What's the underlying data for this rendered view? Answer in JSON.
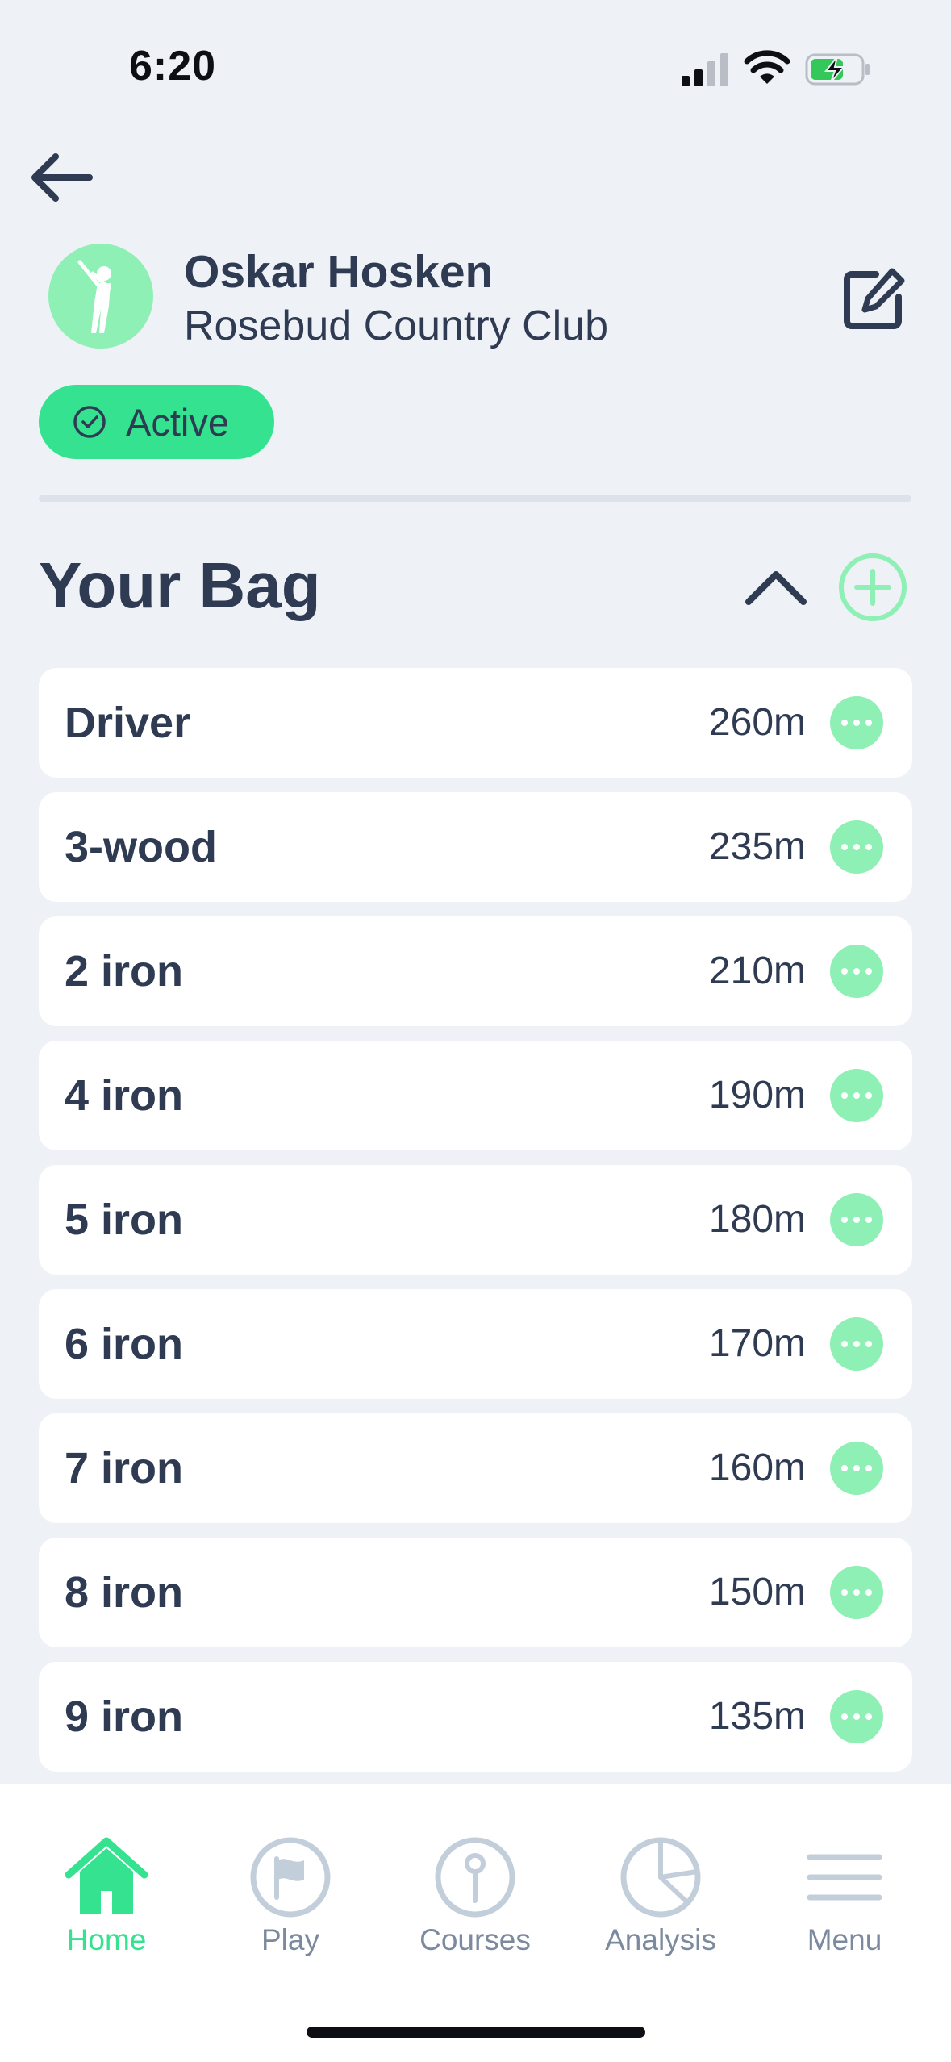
{
  "status_bar": {
    "time": "6:20"
  },
  "profile": {
    "name": "Oskar Hosken",
    "club": "Rosebud Country Club",
    "status": "Active"
  },
  "bag": {
    "title": "Your Bag",
    "clubs": [
      {
        "name": "Driver",
        "distance": "260m"
      },
      {
        "name": "3-wood",
        "distance": "235m"
      },
      {
        "name": "2 iron",
        "distance": "210m"
      },
      {
        "name": "4 iron",
        "distance": "190m"
      },
      {
        "name": "5 iron",
        "distance": "180m"
      },
      {
        "name": "6 iron",
        "distance": "170m"
      },
      {
        "name": "7 iron",
        "distance": "160m"
      },
      {
        "name": "8 iron",
        "distance": "150m"
      },
      {
        "name": "9 iron",
        "distance": "135m"
      }
    ]
  },
  "tab_bar": {
    "items": [
      {
        "label": "Home",
        "icon": "home-icon",
        "active": true
      },
      {
        "label": "Play",
        "icon": "flag-icon",
        "active": false
      },
      {
        "label": "Courses",
        "icon": "pin-icon",
        "active": false
      },
      {
        "label": "Analysis",
        "icon": "pie-chart-icon",
        "active": false
      },
      {
        "label": "Menu",
        "icon": "menu-icon",
        "active": false
      }
    ]
  },
  "colors": {
    "accent": "#34e28f",
    "accent_light": "#8ef0b4",
    "text": "#2f3b52",
    "background": "#eef1f6",
    "inactive": "#c3cedb"
  }
}
